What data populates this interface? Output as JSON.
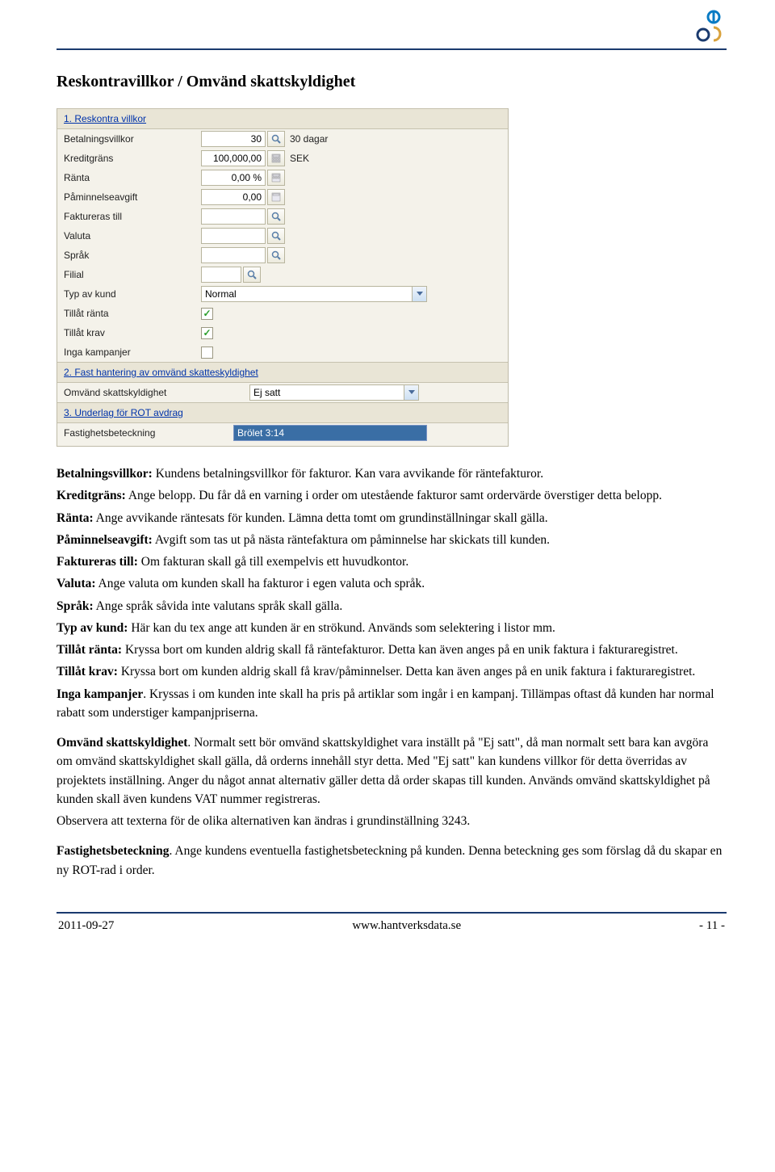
{
  "page": {
    "title": "Reskontravillkor / Omvänd skattskyldighet"
  },
  "panel": {
    "section1": {
      "header": "1. Reskontra villkor",
      "betalningsvillkor_label": "Betalningsvillkor",
      "betalningsvillkor_value": "30",
      "betalningsvillkor_suffix": "30 dagar",
      "kreditgrans_label": "Kreditgräns",
      "kreditgrans_value": "100,000,00",
      "kreditgrans_suffix": "SEK",
      "ranta_label": "Ränta",
      "ranta_value": "0,00 %",
      "paminnelse_label": "Påminnelseavgift",
      "paminnelse_value": "0,00",
      "faktureras_label": "Faktureras till",
      "faktureras_value": "",
      "valuta_label": "Valuta",
      "valuta_value": "",
      "sprak_label": "Språk",
      "sprak_value": "",
      "filial_label": "Filial",
      "filial_value": "",
      "typ_label": "Typ av kund",
      "typ_value": "Normal",
      "tillat_ranta_label": "Tillåt ränta",
      "tillat_ranta_checked": true,
      "tillat_krav_label": "Tillåt krav",
      "tillat_krav_checked": true,
      "inga_kampanjer_label": "Inga kampanjer",
      "inga_kampanjer_checked": false
    },
    "section2": {
      "header": "2. Fast hantering av omvänd skatteskyldighet",
      "omvand_label": "Omvänd skattskyldighet",
      "omvand_value": "Ej satt"
    },
    "section3": {
      "header": "3. Underlag för ROT avdrag",
      "fastighet_label": "Fastighetsbeteckning",
      "fastighet_value": "Brölet 3:14"
    }
  },
  "text": {
    "p1a": "Betalningsvillkor:",
    "p1b": " Kundens betalningsvillkor för fakturor. Kan vara avvikande för räntefakturor.",
    "p2a": "Kreditgräns:",
    "p2b": " Ange belopp. Du får då en varning i order om utestående fakturor samt ordervärde överstiger detta belopp.",
    "p3a": "Ränta:",
    "p3b": " Ange avvikande räntesats för kunden. Lämna detta tomt om grundinställningar skall gälla.",
    "p4a": "Påminnelseavgift:",
    "p4b": " Avgift som tas ut på nästa räntefaktura om påminnelse har skickats till kunden.",
    "p5a": "Faktureras till:",
    "p5b": " Om fakturan skall gå till exempelvis ett huvudkontor.",
    "p6a": "Valuta:",
    "p6b": " Ange valuta om kunden skall ha fakturor i egen valuta och språk.",
    "p7a": "Språk:",
    "p7b": " Ange språk såvida inte valutans språk skall gälla.",
    "p8a": "Typ av kund:",
    "p8b": " Här kan du tex ange att kunden är en strökund. Används som selektering i listor mm.",
    "p9a": "Tillåt ränta:",
    "p9b": " Kryssa bort om kunden aldrig skall få räntefakturor. Detta kan även anges på en unik faktura i fakturaregistret.",
    "p10a": "Tillåt krav:",
    "p10b": " Kryssa bort om kunden aldrig skall få krav/påminnelser. Detta kan även anges på en unik faktura i fakturaregistret.",
    "p11a": "Inga kampanjer",
    "p11b": ". Kryssas i om kunden inte skall ha pris på artiklar som ingår i en kampanj. Tillämpas oftast då kunden har normal rabatt som understiger kampanjpriserna.",
    "p12a": "Omvänd skattskyldighet",
    "p12b": ". Normalt sett bör omvänd skattskyldighet vara inställt på \"Ej satt\", då man normalt sett bara kan avgöra om omvänd skattskyldighet skall gälla, då orderns innehåll styr detta. Med \"Ej satt\" kan kundens villkor för detta överridas av projektets inställning. Anger du något annat alternativ gäller detta då order skapas till kunden. Används omvänd skattskyldighet på kunden skall även kundens VAT nummer registreras.",
    "p12c": "Observera att texterna för de olika alternativen kan ändras i grundinställning 3243.",
    "p13a": "Fastighetsbeteckning",
    "p13b": ". Ange kundens eventuella fastighetsbeteckning på kunden. Denna beteckning ges som förslag då du skapar en ny ROT-rad i order."
  },
  "footer": {
    "date": "2011-09-27",
    "url": "www.hantverksdata.se",
    "page": "- 11 -"
  }
}
